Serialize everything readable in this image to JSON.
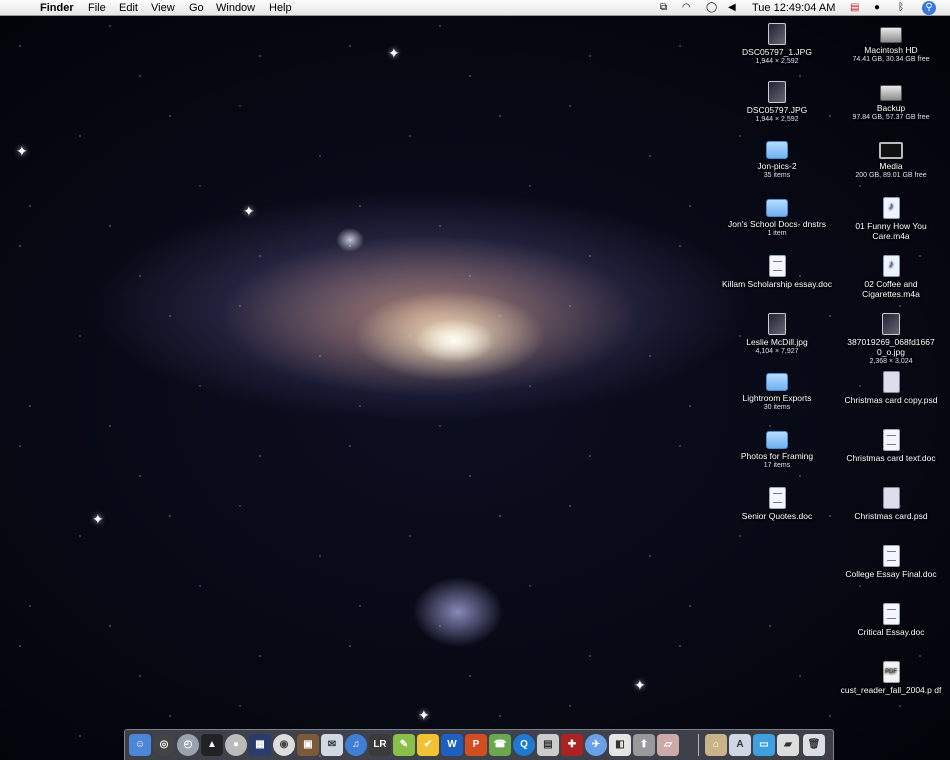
{
  "menubar": {
    "app_name": "Finder",
    "menus": [
      "File",
      "Edit",
      "View",
      "Go",
      "Window",
      "Help"
    ],
    "clock": "Tue 12:49:04 AM"
  },
  "desktop": {
    "col1": [
      {
        "name": "DSC05797_1.JPG",
        "sub": "1,944 × 2,592",
        "icon": "photo"
      },
      {
        "name": "DSC05797.JPG",
        "sub": "1,944 × 2,592",
        "icon": "photo"
      },
      {
        "name": "Jon-pics-2",
        "sub": "35 items",
        "icon": "folder"
      },
      {
        "name": "Jon's School Docs- dnstrs",
        "sub": "1 item",
        "icon": "folder"
      },
      {
        "name": "Killam Scholarship essay.doc",
        "sub": "",
        "icon": "doc"
      },
      {
        "name": "Leslie McDill.jpg",
        "sub": "4,104 × 7,927",
        "icon": "photo"
      },
      {
        "name": "Lightroom Exports",
        "sub": "30 items",
        "icon": "folder"
      },
      {
        "name": "Photos for Framing",
        "sub": "17 items",
        "icon": "folder"
      },
      {
        "name": "Senior Quotes.doc",
        "sub": "",
        "icon": "doc"
      }
    ],
    "col2": [
      {
        "name": "Macintosh HD",
        "sub": "74.41 GB, 30.34 GB free",
        "icon": "drive"
      },
      {
        "name": "Backup",
        "sub": "97.84 GB, 57.37 GB free",
        "icon": "drive"
      },
      {
        "name": "Media",
        "sub": "200 GB, 89.01 GB free",
        "icon": "monitor"
      },
      {
        "name": "01 Funny How You Care.m4a",
        "sub": "",
        "icon": "audio"
      },
      {
        "name": "02 Coffee and Cigarettes.m4a",
        "sub": "",
        "icon": "audio"
      },
      {
        "name": "387019269_068fd1667 0_o.jpg",
        "sub": "2,368 × 3,024",
        "icon": "photo"
      },
      {
        "name": "Christmas card copy.psd",
        "sub": "",
        "icon": "psd"
      },
      {
        "name": "Christmas card text.doc",
        "sub": "",
        "icon": "doc"
      },
      {
        "name": "Christmas card.psd",
        "sub": "",
        "icon": "psd"
      },
      {
        "name": "College Essay Final.doc",
        "sub": "",
        "icon": "doc"
      },
      {
        "name": "Critical Essay.doc",
        "sub": "",
        "icon": "doc"
      },
      {
        "name": "cust_reader_fall_2004.p df",
        "sub": "",
        "icon": "pdf"
      }
    ]
  },
  "dock": {
    "app_labels": {
      "lightroom": "LR"
    },
    "colors": {
      "finder": "#4c86d8",
      "dashboard": "#444444",
      "timemachine": "#9aa3ad",
      "photoshop": "#2a3c6b",
      "mail": "#d0d8e6",
      "ical": "#ffffff",
      "itunes": "#3f7fd3",
      "iphoto": "#7a5a3a",
      "lightroom": "#3a3a3a",
      "trash": "#d9dde4"
    }
  }
}
